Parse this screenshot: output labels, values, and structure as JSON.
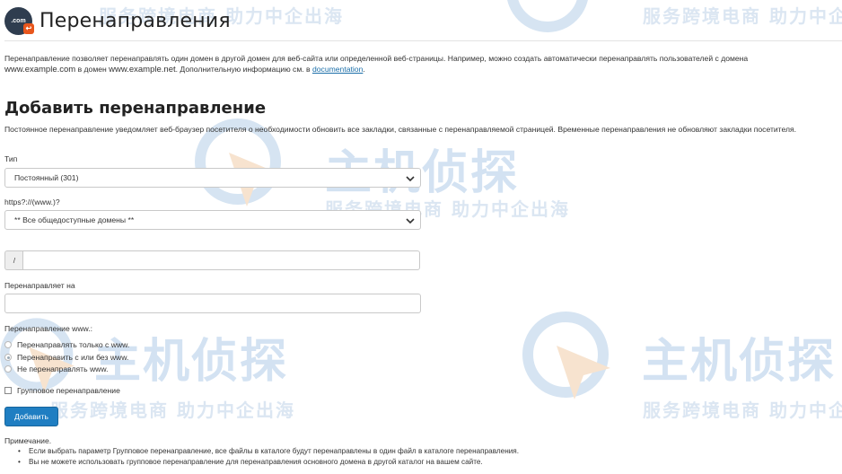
{
  "header": {
    "icon_text": ".com",
    "title": "Перенаправления"
  },
  "intro": {
    "part1": "Перенаправление позволяет перенаправлять один домен в другой домен для веб-сайта или определенной веб-страницы. Например, можно создать автоматически перенаправлять пользователей с домена",
    "example1": "www.example.com",
    "part2": " в домен ",
    "example2": "www.example.net",
    "part3": ". Дополнительную информацию см. в ",
    "link": "documentation",
    "part4": "."
  },
  "section": {
    "title": "Добавить перенаправление",
    "description": "Постоянное перенаправление уведомляет веб-браузер посетителя о необходимости обновить все закладки, связанные с перенаправляемой страницей. Временные перенаправления не обновляют закладки посетителя."
  },
  "form": {
    "type_label": "Тип",
    "type_value": "Постоянный (301)",
    "domain_label": "https?://(www.)?",
    "domain_value": "** Все общедоступные домены **",
    "path_prefix": "/",
    "target_label": "Перенаправляет на",
    "www_label": "Перенаправление www.:",
    "www_options": [
      {
        "label": "Перенаправлять только с www.",
        "checked": false
      },
      {
        "label": "Перенаправить с или без www.",
        "checked": true
      },
      {
        "label": "Не перенаправлять www.",
        "checked": false
      }
    ],
    "wildcard_label": "Групповое перенаправление",
    "submit_label": "Добавить"
  },
  "note": {
    "title": "Примечание.",
    "items": [
      "Если выбрать параметр Групповое перенаправление, все файлы в каталоге будут перенаправлены в один файл в каталоге перенаправления.",
      "Вы не можете использовать групповое перенаправление для перенаправления основного домена в другой каталог на вашем сайте."
    ]
  },
  "watermark": {
    "slogan": "服务跨境电商 助力中企出海",
    "brand": "主机侦探"
  },
  "colors": {
    "primary_button": "#1f7ec2",
    "link": "#1a6ea8",
    "icon_bg": "#2f3d4f",
    "icon_badge": "#e8561c"
  }
}
